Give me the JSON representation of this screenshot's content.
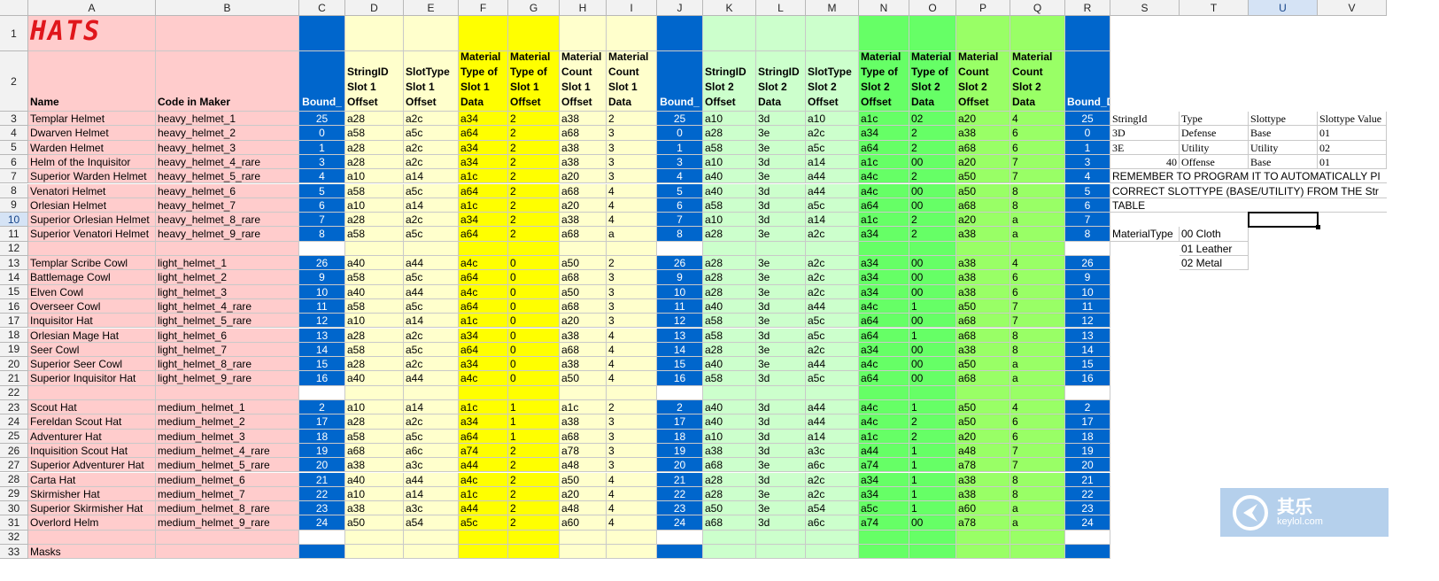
{
  "columns": [
    "A",
    "B",
    "C",
    "D",
    "E",
    "F",
    "G",
    "H",
    "I",
    "J",
    "K",
    "L",
    "M",
    "N",
    "O",
    "P",
    "Q",
    "R",
    "S",
    "T",
    "U",
    "V"
  ],
  "selected_column": "U",
  "selected_row": 10,
  "rows": [
    1,
    2,
    3,
    4,
    5,
    6,
    7,
    8,
    9,
    10,
    11,
    12,
    13,
    14,
    15,
    16,
    17,
    18,
    19,
    20,
    21,
    22,
    23,
    24,
    25,
    26,
    27,
    28,
    29,
    30,
    31,
    32,
    33
  ],
  "title": "HATS",
  "header_row": [
    "Name",
    "Code in Maker",
    "Bound_",
    "StringID Slot 1 Offset",
    "SlotType Slot 1 Offset",
    "Material Type of Slot 1 Data",
    "Material Type of Slot 1 Offset",
    "Material Count Slot 1 Offset",
    "Material Count Slot 1 Data",
    "Bound_",
    "StringID Slot 2 Offset",
    "StringID Slot 2 Data",
    "SlotType Slot 2 Offset",
    "Material Type of Slot 2 Offset",
    "Material Type of Slot 2 Data",
    "Material Count Slot 2 Offset",
    "Material Count Slot 2 Data",
    "Bound_D"
  ],
  "colors": {
    "name": "#ffcccc",
    "bound": "#0066cc",
    "pale_yellow": "#ffffcc",
    "yellow": "#ffff00",
    "pale_green": "#ccffcc",
    "green": "#66ff66",
    "lime": "#99ff66",
    "title": "#e0161b"
  },
  "rows_data": [
    {
      "row": 3,
      "cells": [
        "Templar Helmet",
        "heavy_helmet_1",
        "25",
        "a28",
        "a2c",
        "a34",
        "2",
        "a38",
        "2",
        "25",
        "a10",
        "3d",
        "a10",
        "a1c",
        "02",
        "a20",
        "4",
        "25"
      ]
    },
    {
      "row": 4,
      "cells": [
        "Dwarven Helmet",
        "heavy_helmet_2",
        "0",
        "a58",
        "a5c",
        "a64",
        "2",
        "a68",
        "3",
        "0",
        "a28",
        "3e",
        "a2c",
        "a34",
        "2",
        "a38",
        "6",
        "0"
      ]
    },
    {
      "row": 5,
      "cells": [
        "Warden Helmet",
        "heavy_helmet_3",
        "1",
        "a28",
        "a2c",
        "a34",
        "2",
        "a38",
        "3",
        "1",
        "a58",
        "3e",
        "a5c",
        "a64",
        "2",
        "a68",
        "6",
        "1"
      ]
    },
    {
      "row": 6,
      "cells": [
        "Helm of the Inquisitor",
        "heavy_helmet_4_rare",
        "3",
        "a28",
        "a2c",
        "a34",
        "2",
        "a38",
        "3",
        "3",
        "a10",
        "3d",
        "a14",
        "a1c",
        "00",
        "a20",
        "7",
        "3"
      ]
    },
    {
      "row": 7,
      "cells": [
        "Superior Warden Helmet",
        "heavy_helmet_5_rare",
        "4",
        "a10",
        "a14",
        "a1c",
        "2",
        "a20",
        "3",
        "4",
        "a40",
        "3e",
        "a44",
        "a4c",
        "2",
        "a50",
        "7",
        "4"
      ]
    },
    {
      "row": 8,
      "cells": [
        "Venatori Helmet",
        "heavy_helmet_6",
        "5",
        "a58",
        "a5c",
        "a64",
        "2",
        "a68",
        "4",
        "5",
        "a40",
        "3d",
        "a44",
        "a4c",
        "00",
        "a50",
        "8",
        "5"
      ]
    },
    {
      "row": 9,
      "cells": [
        "Orlesian Helmet",
        "heavy_helmet_7",
        "6",
        "a10",
        "a14",
        "a1c",
        "2",
        "a20",
        "4",
        "6",
        "a58",
        "3d",
        "a5c",
        "a64",
        "00",
        "a68",
        "8",
        "6"
      ]
    },
    {
      "row": 10,
      "cells": [
        "Superior Orlesian Helmet",
        "heavy_helmet_8_rare",
        "7",
        "a28",
        "a2c",
        "a34",
        "2",
        "a38",
        "4",
        "7",
        "a10",
        "3d",
        "a14",
        "a1c",
        "2",
        "a20",
        "a",
        "7"
      ]
    },
    {
      "row": 11,
      "cells": [
        "Superior Venatori Helmet",
        "heavy_helmet_9_rare",
        "8",
        "a58",
        "a5c",
        "a64",
        "2",
        "a68",
        "a",
        "8",
        "a28",
        "3e",
        "a2c",
        "a34",
        "2",
        "a38",
        "a",
        "8"
      ]
    },
    {
      "row": 13,
      "cells": [
        "Templar Scribe Cowl",
        "light_helmet_1",
        "26",
        "a40",
        "a44",
        "a4c",
        "0",
        "a50",
        "2",
        "26",
        "a28",
        "3e",
        "a2c",
        "a34",
        "00",
        "a38",
        "4",
        "26"
      ]
    },
    {
      "row": 14,
      "cells": [
        "Battlemage Cowl",
        "light_helmet_2",
        "9",
        "a58",
        "a5c",
        "a64",
        "0",
        "a68",
        "3",
        "9",
        "a28",
        "3e",
        "a2c",
        "a34",
        "00",
        "a38",
        "6",
        "9"
      ]
    },
    {
      "row": 15,
      "cells": [
        "Elven Cowl",
        "light_helmet_3",
        "10",
        "a40",
        "a44",
        "a4c",
        "0",
        "a50",
        "3",
        "10",
        "a28",
        "3e",
        "a2c",
        "a34",
        "00",
        "a38",
        "6",
        "10"
      ]
    },
    {
      "row": 16,
      "cells": [
        "Overseer Cowl",
        "light_helmet_4_rare",
        "11",
        "a58",
        "a5c",
        "a64",
        "0",
        "a68",
        "3",
        "11",
        "a40",
        "3d",
        "a44",
        "a4c",
        "1",
        "a50",
        "7",
        "11"
      ]
    },
    {
      "row": 17,
      "cells": [
        "Inquisitor Hat",
        "light_helmet_5_rare",
        "12",
        "a10",
        "a14",
        "a1c",
        "0",
        "a20",
        "3",
        "12",
        "a58",
        "3e",
        "a5c",
        "a64",
        "00",
        "a68",
        "7",
        "12"
      ]
    },
    {
      "row": 18,
      "cells": [
        "Orlesian Mage Hat",
        "light_helmet_6",
        "13",
        "a28",
        "a2c",
        "a34",
        "0",
        "a38",
        "4",
        "13",
        "a58",
        "3d",
        "a5c",
        "a64",
        "1",
        "a68",
        "8",
        "13"
      ]
    },
    {
      "row": 19,
      "cells": [
        "Seer Cowl",
        "light_helmet_7",
        "14",
        "a58",
        "a5c",
        "a64",
        "0",
        "a68",
        "4",
        "14",
        "a28",
        "3e",
        "a2c",
        "a34",
        "00",
        "a38",
        "8",
        "14"
      ]
    },
    {
      "row": 20,
      "cells": [
        "Superior Seer Cowl",
        "light_helmet_8_rare",
        "15",
        "a28",
        "a2c",
        "a34",
        "0",
        "a38",
        "4",
        "15",
        "a40",
        "3e",
        "a44",
        "a4c",
        "00",
        "a50",
        "a",
        "15"
      ]
    },
    {
      "row": 21,
      "cells": [
        "Superior Inquisitor Hat",
        "light_helmet_9_rare",
        "16",
        "a40",
        "a44",
        "a4c",
        "0",
        "a50",
        "4",
        "16",
        "a58",
        "3d",
        "a5c",
        "a64",
        "00",
        "a68",
        "a",
        "16"
      ]
    },
    {
      "row": 23,
      "cells": [
        "Scout Hat",
        "medium_helmet_1",
        "2",
        "a10",
        "a14",
        "a1c",
        "1",
        "a1c",
        "2",
        "2",
        "a40",
        "3d",
        "a44",
        "a4c",
        "1",
        "a50",
        "4",
        "2"
      ]
    },
    {
      "row": 24,
      "cells": [
        "Fereldan Scout Hat",
        "medium_helmet_2",
        "17",
        "a28",
        "a2c",
        "a34",
        "1",
        "a38",
        "3",
        "17",
        "a40",
        "3d",
        "a44",
        "a4c",
        "2",
        "a50",
        "6",
        "17"
      ]
    },
    {
      "row": 25,
      "cells": [
        "Adventurer Hat",
        "medium_helmet_3",
        "18",
        "a58",
        "a5c",
        "a64",
        "1",
        "a68",
        "3",
        "18",
        "a10",
        "3d",
        "a14",
        "a1c",
        "2",
        "a20",
        "6",
        "18"
      ]
    },
    {
      "row": 26,
      "cells": [
        "Inquisition Scout Hat",
        "medium_helmet_4_rare",
        "19",
        "a68",
        "a6c",
        "a74",
        "2",
        "a78",
        "3",
        "19",
        "a38",
        "3d",
        "a3c",
        "a44",
        "1",
        "a48",
        "7",
        "19"
      ]
    },
    {
      "row": 27,
      "cells": [
        "Superior Adventurer Hat",
        "medium_helmet_5_rare",
        "20",
        "a38",
        "a3c",
        "a44",
        "2",
        "a48",
        "3",
        "20",
        "a68",
        "3e",
        "a6c",
        "a74",
        "1",
        "a78",
        "7",
        "20"
      ]
    },
    {
      "row": 28,
      "cells": [
        "Carta Hat",
        "medium_helmet_6",
        "21",
        "a40",
        "a44",
        "a4c",
        "2",
        "a50",
        "4",
        "21",
        "a28",
        "3d",
        "a2c",
        "a34",
        "1",
        "a38",
        "8",
        "21"
      ]
    },
    {
      "row": 29,
      "cells": [
        "Skirmisher Hat",
        "medium_helmet_7",
        "22",
        "a10",
        "a14",
        "a1c",
        "2",
        "a20",
        "4",
        "22",
        "a28",
        "3e",
        "a2c",
        "a34",
        "1",
        "a38",
        "8",
        "22"
      ]
    },
    {
      "row": 30,
      "cells": [
        "Superior Skirmisher Hat",
        "medium_helmet_8_rare",
        "23",
        "a38",
        "a3c",
        "a44",
        "2",
        "a48",
        "4",
        "23",
        "a50",
        "3e",
        "a54",
        "a5c",
        "1",
        "a60",
        "a",
        "23"
      ]
    },
    {
      "row": 31,
      "cells": [
        "Overlord Helm",
        "medium_helmet_9_rare",
        "24",
        "a50",
        "a54",
        "a5c",
        "2",
        "a60",
        "4",
        "24",
        "a68",
        "3d",
        "a6c",
        "a74",
        "00",
        "a78",
        "a",
        "24"
      ]
    }
  ],
  "row33_label": "Masks",
  "side_table": {
    "header": [
      "StringId",
      "Type",
      "Slottype",
      "Slottype Value"
    ],
    "rows": [
      [
        "3D",
        "Defense",
        "Base",
        "01"
      ],
      [
        "3E",
        "Utility",
        "Utility",
        "02"
      ],
      [
        "40",
        "Offense",
        "Base",
        "01"
      ]
    ]
  },
  "note_lines": [
    "REMEMBER TO PROGRAM IT TO AUTOMATICALLY PI",
    "CORRECT SLOTTYPE (BASE/UTILITY) FROM THE Str",
    "TABLE"
  ],
  "material_type": {
    "label": "MaterialType",
    "items": [
      "00 Cloth",
      "01 Leather",
      "02 Metal"
    ]
  },
  "watermark": {
    "cn": "其乐",
    "url": "keylol.com"
  }
}
